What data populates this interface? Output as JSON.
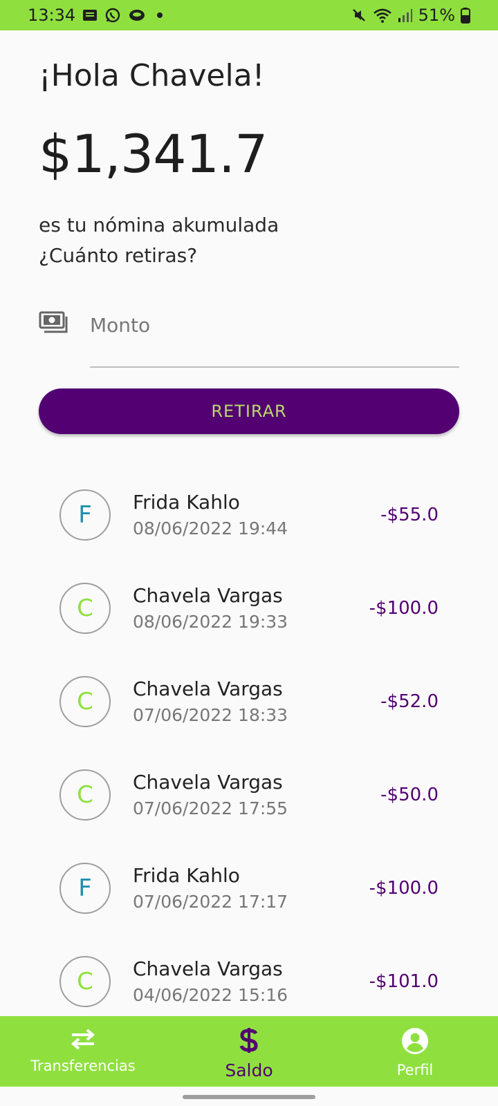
{
  "status_bar": {
    "time": "13:34",
    "battery": "51%"
  },
  "greeting": "¡Hola Chavela!",
  "balance": "$1,341.7",
  "subtitle_line1": "es tu nómina akumulada",
  "subtitle_line2": "¿Cuánto retiras?",
  "amount_field": {
    "placeholder": "Monto",
    "icon": "cash-icon"
  },
  "withdraw_button": "RETIRAR",
  "transactions": [
    {
      "initial": "F",
      "name": "Frida Kahlo",
      "date": "08/06/2022 19:44",
      "amount": "-$55.0",
      "color": "#1e8eb0"
    },
    {
      "initial": "C",
      "name": "Chavela Vargas",
      "date": "08/06/2022 19:33",
      "amount": "-$100.0",
      "color": "#8fe03f"
    },
    {
      "initial": "C",
      "name": "Chavela Vargas",
      "date": "07/06/2022 18:33",
      "amount": "-$52.0",
      "color": "#8fe03f"
    },
    {
      "initial": "C",
      "name": "Chavela Vargas",
      "date": "07/06/2022 17:55",
      "amount": "-$50.0",
      "color": "#8fe03f"
    },
    {
      "initial": "F",
      "name": "Frida Kahlo",
      "date": "07/06/2022 17:17",
      "amount": "-$100.0",
      "color": "#1e8eb0"
    },
    {
      "initial": "C",
      "name": "Chavela Vargas",
      "date": "04/06/2022 15:16",
      "amount": "-$101.0",
      "color": "#8fe03f"
    }
  ],
  "bottom_nav": [
    {
      "label": "Transferencias",
      "icon": "transfer-icon",
      "active": false
    },
    {
      "label": "Saldo",
      "icon": "dollar-icon",
      "active": true
    },
    {
      "label": "Perfil",
      "icon": "profile-icon",
      "active": false
    }
  ],
  "colors": {
    "accent_green": "#8fe03f",
    "brand_purple": "#520072",
    "button_text": "#b9d96a"
  }
}
